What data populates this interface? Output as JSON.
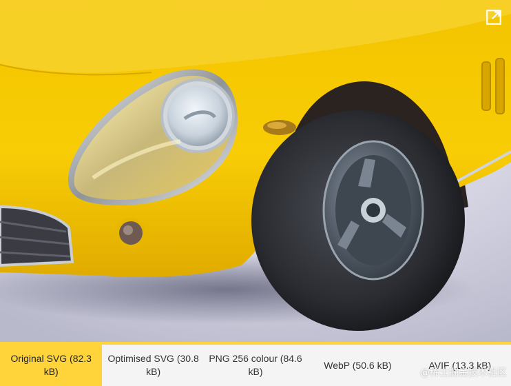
{
  "viewer": {
    "image_subject": "yellow vintage sports car front wheel and headlight",
    "expand_icon": "open-in-new-icon"
  },
  "tabs": [
    {
      "label": "Original SVG (82.3 kB)",
      "active": true
    },
    {
      "label": "Optimised SVG (30.8 kB)",
      "active": false
    },
    {
      "label": "PNG 256 colour (84.6 kB)",
      "active": false
    },
    {
      "label": "WebP (50.6 kB)",
      "active": false
    },
    {
      "label": "AVIF (13.3 kB)",
      "active": false
    }
  ],
  "watermark": "@稀土掘金技术社区",
  "colors": {
    "accent": "#ffd43b",
    "car_body": "#f5c400",
    "tab_bar": "#f4f4f4"
  }
}
